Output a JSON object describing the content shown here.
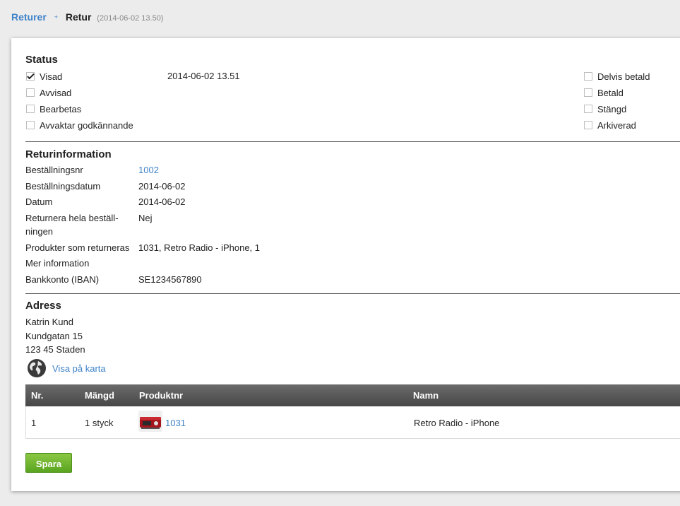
{
  "breadcrumb": {
    "parent": "Returer",
    "separator": "+",
    "current": "Retur",
    "timestamp": "(2014-06-02 13.50)"
  },
  "status": {
    "heading": "Status",
    "date": "2014-06-02 13.51",
    "left_items": [
      {
        "label": "Visad",
        "checked": true
      },
      {
        "label": "Avvisad",
        "checked": false
      },
      {
        "label": "Bearbetas",
        "checked": false
      },
      {
        "label": "Avvaktar godkännande",
        "checked": false
      }
    ],
    "right_items": [
      {
        "label": "Delvis betald",
        "checked": false
      },
      {
        "label": "Betald",
        "checked": false
      },
      {
        "label": "Stängd",
        "checked": false
      },
      {
        "label": "Arkiverad",
        "checked": false
      }
    ]
  },
  "return_info": {
    "heading": "Returinformation",
    "rows": [
      {
        "label": "Beställningsnr",
        "value": "1002"
      },
      {
        "label": "Beställningsdatum",
        "value": "2014-06-02"
      },
      {
        "label": "Datum",
        "value": "2014-06-02"
      },
      {
        "label": "Returnera hela beställ­ningen",
        "value": "Nej"
      },
      {
        "label": "Produkter som returneras",
        "value": "1031, Retro Radio - iPhone, 1"
      },
      {
        "label": "Mer information",
        "value": ""
      },
      {
        "label": "Bankkonto (IBAN)",
        "value": "SE1234567890"
      }
    ]
  },
  "address": {
    "heading": "Adress",
    "lines": [
      "Katrin Kund",
      "Kundgatan 15",
      "123 45 Staden"
    ],
    "map_link": "Visa på karta",
    "map_icon": "globe-icon"
  },
  "products_table": {
    "columns": [
      "Nr.",
      "Mängd",
      "Produktnr",
      "Namn"
    ],
    "rows": [
      {
        "nr": "1",
        "quantity": "1 styck",
        "product_no": "1031",
        "name": "Retro Radio - iPhone",
        "thumbnail": "retro-radio-thumbnail"
      }
    ]
  },
  "actions": {
    "save_label": "Spara"
  },
  "colors": {
    "link": "#3f83c8",
    "save_button": "#6fb531",
    "table_header": "#555555"
  }
}
